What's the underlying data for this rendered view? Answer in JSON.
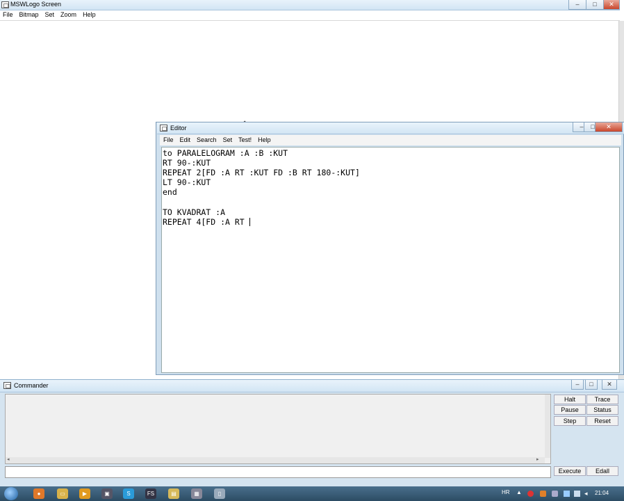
{
  "main_window": {
    "title": "MSWLogo Screen",
    "menu": [
      "File",
      "Bitmap",
      "Set",
      "Zoom",
      "Help"
    ]
  },
  "editor": {
    "title": "Editor",
    "menu": [
      "File",
      "Edit",
      "Search",
      "Set",
      "Test!",
      "Help"
    ],
    "lines": [
      "to PARALELOGRAM :A :B :KUT",
      "RT 90-:KUT",
      "REPEAT 2[FD :A RT :KUT FD :B RT 180-:KUT]",
      "LT 90-:KUT",
      "end",
      "",
      "TO KVADRAT :A",
      "REPEAT 4[FD :A RT "
    ]
  },
  "commander": {
    "title": "Commander",
    "buttons": {
      "halt": "Halt",
      "trace": "Trace",
      "pause": "Pause",
      "status": "Status",
      "step": "Step",
      "reset": "Reset",
      "execute": "Execute",
      "edall": "Edall"
    },
    "input_value": ""
  },
  "taskbar": {
    "language": "HR",
    "clock": "21:04"
  }
}
